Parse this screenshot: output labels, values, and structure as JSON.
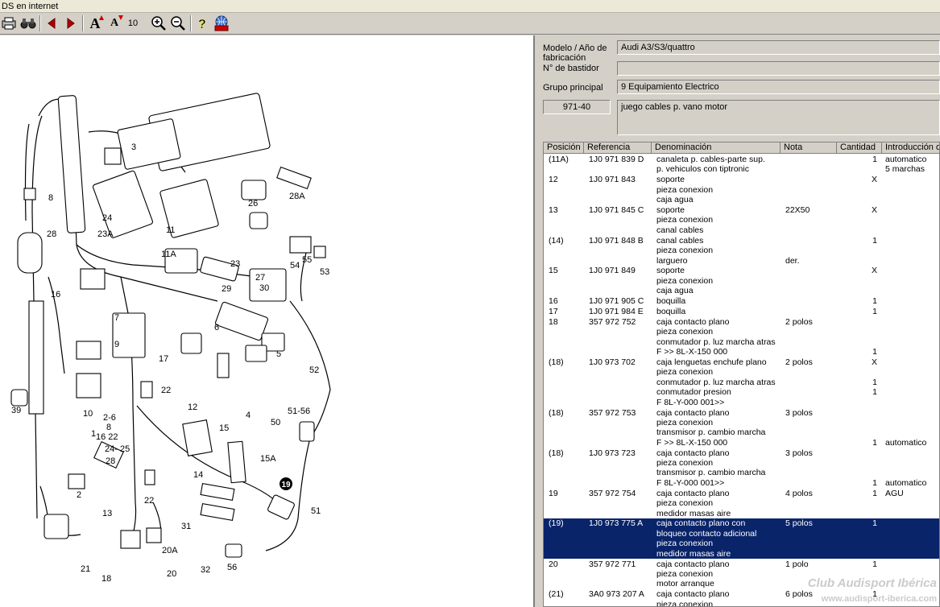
{
  "window": {
    "title": "DS  en internet"
  },
  "toolbar": {
    "font_size_value": "10",
    "font_up_label": "A",
    "font_down_label": "A",
    "help_label": "?"
  },
  "header": {
    "model_label": "Modelo / Año de fabricación",
    "model_value": "Audi A3/S3/quattro",
    "chassis_label": "N° de bastidor",
    "chassis_value": "",
    "group_label": "Grupo principal",
    "group_value": "9  Equipamiento Electrico",
    "subgroup_code": "971-40",
    "subgroup_desc": "juego cables p. vano motor"
  },
  "table": {
    "columns": [
      "Posición",
      "Referencia",
      "Denominación",
      "Nota",
      "Cantidad",
      "Introducción de"
    ],
    "rows": [
      {
        "pos": "(11A)",
        "ref": "1J0 971 839 D",
        "den": [
          "canaleta p. cables-parte sup.",
          "p. vehiculos con tiptronic"
        ],
        "nota": [],
        "cant": [
          "1"
        ],
        "intro": [
          "automatico",
          "5 marchas"
        ],
        "selected": false
      },
      {
        "pos": "12",
        "ref": "1J0 971 843",
        "den": [
          "soporte",
          "pieza conexion",
          "caja agua"
        ],
        "nota": [],
        "cant": [
          "X"
        ],
        "intro": [],
        "selected": false
      },
      {
        "pos": "13",
        "ref": "1J0 971 845 C",
        "den": [
          "soporte",
          "pieza conexion",
          "canal cables"
        ],
        "nota": [
          "22X50"
        ],
        "cant": [
          "X"
        ],
        "intro": [],
        "selected": false
      },
      {
        "pos": "(14)",
        "ref": "1J0 971 848 B",
        "den": [
          "canal cables",
          "pieza conexion",
          "larguero"
        ],
        "nota": [
          "",
          "",
          "der."
        ],
        "cant": [
          "1"
        ],
        "intro": [],
        "selected": false
      },
      {
        "pos": "15",
        "ref": "1J0 971 849",
        "den": [
          "soporte",
          "pieza conexion",
          "caja agua"
        ],
        "nota": [],
        "cant": [
          "X"
        ],
        "intro": [],
        "selected": false
      },
      {
        "pos": "16",
        "ref": "1J0 971 905 C",
        "den": [
          "boquilla"
        ],
        "nota": [],
        "cant": [
          "1"
        ],
        "intro": [],
        "selected": false
      },
      {
        "pos": "17",
        "ref": "1J0 971 984 E",
        "den": [
          "boquilla"
        ],
        "nota": [],
        "cant": [
          "1"
        ],
        "intro": [],
        "selected": false
      },
      {
        "pos": "18",
        "ref": "357 972 752",
        "den": [
          "caja contacto plano",
          "pieza conexion",
          "conmutador p. luz marcha atras",
          "F           >> 8L-X-150 000"
        ],
        "nota": [
          "2 polos"
        ],
        "cant": [
          "",
          "",
          "",
          "1"
        ],
        "intro": [],
        "selected": false
      },
      {
        "pos": "(18)",
        "ref": "1J0 973 702",
        "den": [
          "caja lenguetas enchufe plano",
          "pieza conexion",
          "conmutador p. luz marcha atras",
          "conmutador presion",
          "F 8L-Y-000 001>>"
        ],
        "nota": [
          "2 polos"
        ],
        "cant": [
          "X",
          "",
          "1",
          "1"
        ],
        "intro": [],
        "selected": false
      },
      {
        "pos": "(18)",
        "ref": "357 972 753",
        "den": [
          "caja contacto plano",
          "pieza conexion",
          "transmisor p. cambio marcha",
          "F           >> 8L-X-150 000"
        ],
        "nota": [
          "3 polos"
        ],
        "cant": [
          "",
          "",
          "",
          "1"
        ],
        "intro": [
          "",
          "",
          "",
          "automatico"
        ],
        "selected": false
      },
      {
        "pos": "(18)",
        "ref": "1J0 973 723",
        "den": [
          "caja contacto plano",
          "pieza conexion",
          "transmisor p. cambio marcha",
          "F 8L-Y-000 001>>"
        ],
        "nota": [
          "3 polos"
        ],
        "cant": [
          "",
          "",
          "",
          "1"
        ],
        "intro": [
          "",
          "",
          "",
          "automatico"
        ],
        "selected": false
      },
      {
        "pos": "19",
        "ref": "357 972 754",
        "den": [
          "caja contacto plano",
          "pieza conexion",
          "medidor masas aire"
        ],
        "nota": [
          "4 polos"
        ],
        "cant": [
          "1"
        ],
        "intro": [
          "AGU"
        ],
        "selected": false
      },
      {
        "pos": "(19)",
        "ref": "1J0 973 775 A",
        "den": [
          "caja contacto plano con",
          "bloqueo contacto adicional",
          "pieza conexion",
          "medidor masas aire"
        ],
        "nota": [
          "5 polos"
        ],
        "cant": [
          "1"
        ],
        "intro": [],
        "selected": true
      },
      {
        "pos": "20",
        "ref": "357 972 771",
        "den": [
          "caja contacto plano",
          "pieza conexion",
          "motor arranque"
        ],
        "nota": [
          "1 polo"
        ],
        "cant": [
          "1"
        ],
        "intro": [],
        "selected": false
      },
      {
        "pos": "(21)",
        "ref": "3A0 973 207 A",
        "den": [
          "caja contacto plano",
          "pieza conexion"
        ],
        "nota": [
          "6 polos"
        ],
        "cant": [
          "1"
        ],
        "intro": [],
        "selected": false
      }
    ]
  },
  "diagram": {
    "labels": [
      "3",
      "8",
      "24",
      "28A",
      "26",
      "28",
      "23A",
      "11",
      "11A",
      "23",
      "27",
      "54",
      "55",
      "53",
      "16",
      "29",
      "30",
      "7",
      "9",
      "6",
      "17",
      "5",
      "52",
      "22",
      "12",
      "4",
      "39",
      "10",
      "1",
      "2-6",
      "8",
      "16 22",
      "24- 25",
      "28",
      "15",
      "51-56",
      "50",
      "15A",
      "14",
      "2",
      "22",
      "13",
      "19",
      "51",
      "31",
      "20A",
      "32",
      "56",
      "18",
      "20",
      "21"
    ],
    "callout": "19"
  },
  "watermark": {
    "title": "Club Audisport Ibérica",
    "url": "www.audisport-iberica.com"
  }
}
